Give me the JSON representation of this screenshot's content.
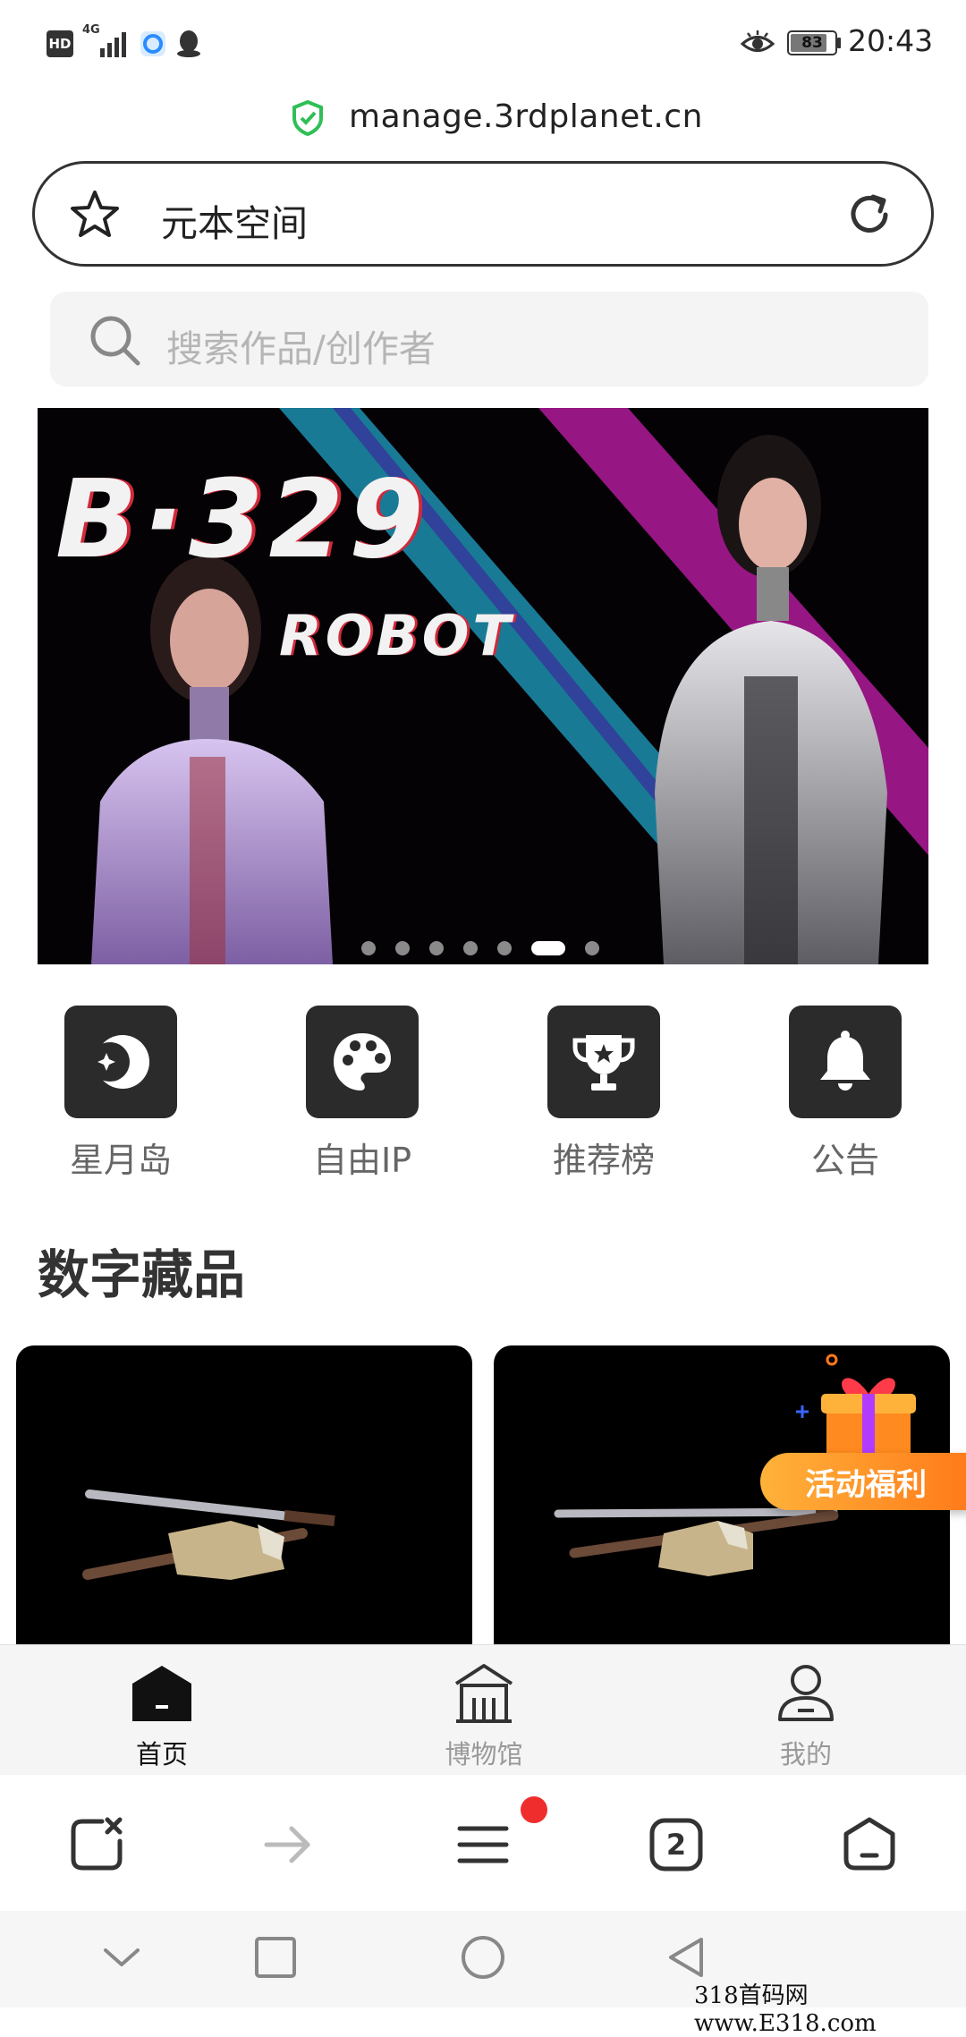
{
  "status_bar": {
    "hd_label": "HD",
    "network_label": "4G",
    "battery_percent": 83,
    "battery_text": "83",
    "time": "20:43",
    "icons": [
      "hd-icon",
      "signal-icon",
      "qq-app-icon",
      "penguin-icon",
      "eye-icon",
      "battery-icon"
    ]
  },
  "browser": {
    "url": "manage.3rdplanet.cn",
    "page_title": "元本空间",
    "tab_count": "2",
    "menu_badge_color": "#f02d2d"
  },
  "search": {
    "placeholder": "搜索作品/创作者"
  },
  "banner": {
    "title_text": "B·329",
    "subtitle_text": "ROBOT",
    "slide_count": 7,
    "active_slide_index": 5
  },
  "quick_entries": [
    {
      "label": "星月岛",
      "icon": "moon-star-icon"
    },
    {
      "label": "自由IP",
      "icon": "palette-icon"
    },
    {
      "label": "推荐榜",
      "icon": "trophy-icon"
    },
    {
      "label": "公告",
      "icon": "bell-icon"
    }
  ],
  "section": {
    "title": "数字藏品"
  },
  "promo": {
    "label": "活动福利",
    "icon": "gift-icon"
  },
  "tabbar": [
    {
      "label": "首页",
      "icon": "home-icon",
      "active": true
    },
    {
      "label": "博物馆",
      "icon": "museum-icon",
      "active": false
    },
    {
      "label": "我的",
      "icon": "user-icon",
      "active": false
    }
  ],
  "browser_toolbar": [
    "close-tab-icon",
    "forward-icon",
    "menu-icon",
    "tabs-icon",
    "home-icon"
  ],
  "system_nav": [
    "collapse-icon",
    "recents-icon",
    "home-circle-icon",
    "back-icon"
  ],
  "watermark": "318首码网  www.E318.com",
  "colors": {
    "promo_orange": "#ff8a1f",
    "tile_dark": "#2b2b2b",
    "shield_green": "#2fbf56"
  }
}
